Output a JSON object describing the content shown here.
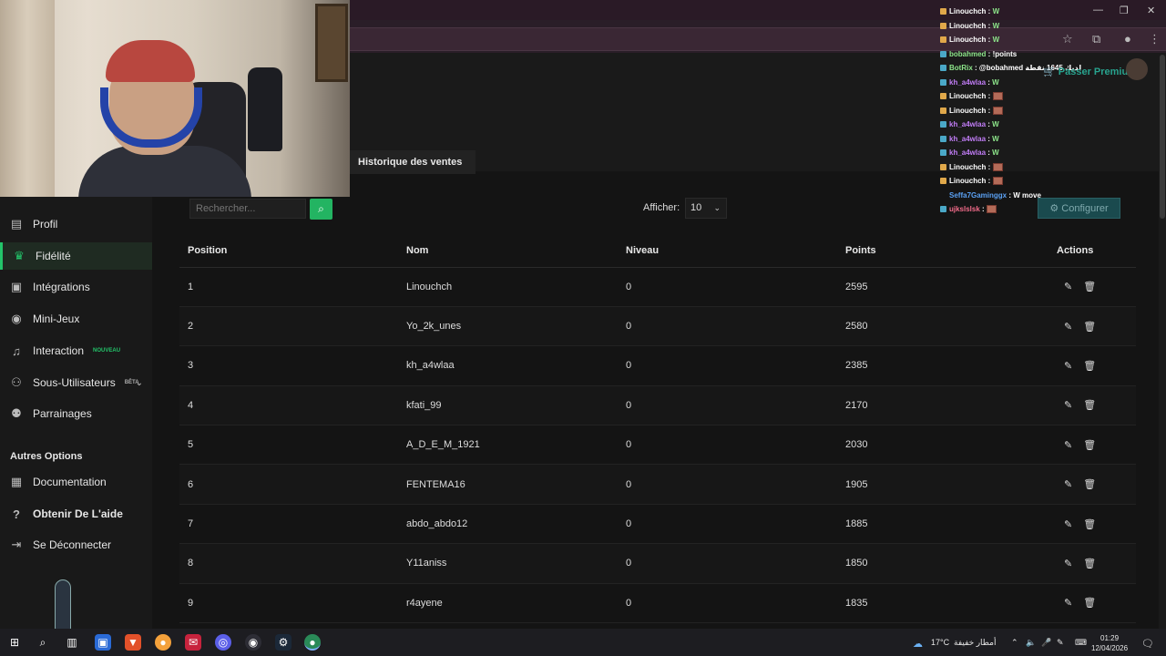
{
  "browser": {
    "window_controls": [
      "—",
      "❐",
      "✕"
    ],
    "toolbar_icons": [
      "star-icon",
      "extensions-icon",
      "profile-icon",
      "menu-icon"
    ]
  },
  "tab": {
    "title": "Historique des ventes"
  },
  "sidebar": {
    "items": [
      {
        "label": "Profil",
        "icon": "id-card-icon",
        "active": false,
        "badge": ""
      },
      {
        "label": "Fidélité",
        "icon": "trophy-icon",
        "active": true,
        "badge": ""
      },
      {
        "label": "Intégrations",
        "icon": "integrations-icon",
        "active": false,
        "badge": ""
      },
      {
        "label": "Mini-Jeux",
        "icon": "gamepad-icon",
        "active": false,
        "badge": ""
      },
      {
        "label": "Interaction",
        "icon": "music-icon",
        "active": false,
        "badge": "NOUVEAU"
      },
      {
        "label": "Sous-Utilisateurs",
        "icon": "users-icon",
        "active": false,
        "badge": "BÊTA"
      },
      {
        "label": "Parrainages",
        "icon": "group-icon",
        "active": false,
        "badge": ""
      }
    ],
    "section_title": "Autres Options",
    "other_items": [
      {
        "label": "Documentation",
        "icon": "doc-icon"
      },
      {
        "label": "Obtenir De L'aide",
        "icon": "help-icon"
      },
      {
        "label": "Se Déconnecter",
        "icon": "logout-icon"
      }
    ]
  },
  "toolbar": {
    "search_placeholder": "Rechercher...",
    "show_label": "Afficher:",
    "page_size": "10",
    "configure_label": "Configurer"
  },
  "table": {
    "headers": [
      "Position",
      "Nom",
      "Niveau",
      "Points",
      "Actions"
    ],
    "rows": [
      [
        "1",
        "Linouchch",
        "0",
        "2595"
      ],
      [
        "2",
        "Yo_2k_unes",
        "0",
        "2580"
      ],
      [
        "3",
        "kh_a4wlaa",
        "0",
        "2385"
      ],
      [
        "4",
        "kfati_99",
        "0",
        "2170"
      ],
      [
        "5",
        "A_D_E_M_1921",
        "0",
        "2030"
      ],
      [
        "6",
        "FENTEMA16",
        "0",
        "1905"
      ],
      [
        "7",
        "abdo_abdo12",
        "0",
        "1885"
      ],
      [
        "8",
        "Y11aniss",
        "0",
        "1850"
      ],
      [
        "9",
        "r4ayene",
        "0",
        "1835"
      ]
    ]
  },
  "chat": {
    "messages": [
      {
        "user": "Linouchch",
        "text": "W",
        "color": "#ffffff",
        "emote": false
      },
      {
        "user": "Linouchch",
        "text": "W",
        "color": "#ffffff",
        "emote": false
      },
      {
        "user": "Linouchch",
        "text": "W",
        "color": "#ffffff",
        "emote": false
      },
      {
        "user": "bobahmed",
        "text": "!points",
        "color": "#8de58a",
        "emote": false
      },
      {
        "user": "BotRix",
        "text": "@bobahmed لديك 1645 نقطة",
        "color": "#8de58a",
        "emote": false
      },
      {
        "user": "kh_a4wlaa",
        "text": "W",
        "color": "#c07cf5",
        "emote": false
      },
      {
        "user": "Linouchch",
        "text": "",
        "color": "#ffffff",
        "emote": true
      },
      {
        "user": "Linouchch",
        "text": "",
        "color": "#ffffff",
        "emote": true
      },
      {
        "user": "kh_a4wlaa",
        "text": "W",
        "color": "#c07cf5",
        "emote": false
      },
      {
        "user": "kh_a4wlaa",
        "text": "W",
        "color": "#c07cf5",
        "emote": false
      },
      {
        "user": "kh_a4wlaa",
        "text": "W",
        "color": "#c07cf5",
        "emote": false
      },
      {
        "user": "Linouchch",
        "text": "",
        "color": "#ffffff",
        "emote": true
      },
      {
        "user": "Linouchch",
        "text": "",
        "color": "#ffffff",
        "emote": true
      },
      {
        "user": "Seffa7Gaminggx",
        "text": "W move",
        "color": "#5aa0f2",
        "emote": false
      },
      {
        "user": "ujkslslsk",
        "text": "",
        "color": "#f26b8a",
        "emote": true
      }
    ],
    "premium_label": "Passer Premium"
  },
  "taskbar": {
    "weather": "17°C",
    "weather_text": "أمطار خفيفة",
    "time": "01:29",
    "date": "12/04/2026"
  },
  "colors": {
    "accent": "#23b462",
    "background": "#141414",
    "sidebar": "#191919",
    "configure": "#1a4a4e"
  }
}
